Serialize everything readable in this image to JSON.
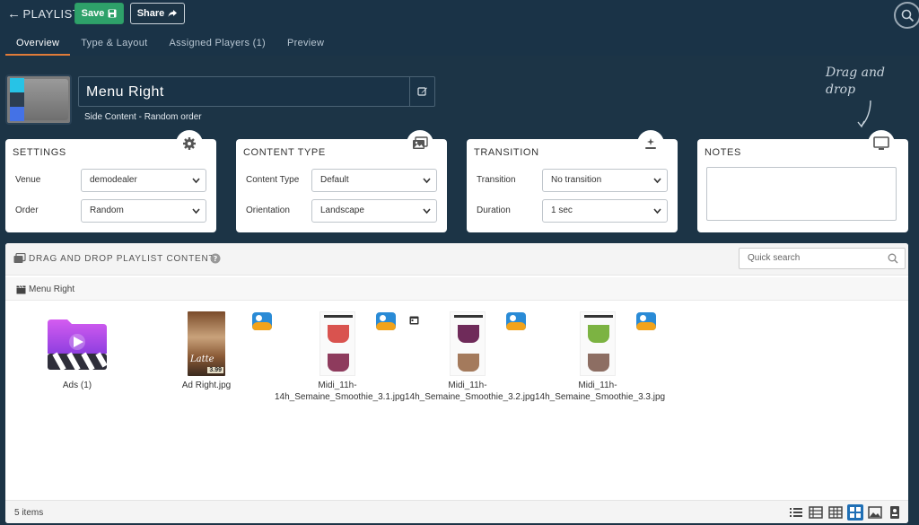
{
  "topbar": {
    "back_label": "PLAYLIST",
    "save_label": "Save",
    "share_label": "Share"
  },
  "tabs": [
    {
      "label": "Overview",
      "active": true
    },
    {
      "label": "Type & Layout",
      "active": false
    },
    {
      "label": "Assigned Players (1)",
      "active": false
    },
    {
      "label": "Preview",
      "active": false
    }
  ],
  "playlist": {
    "title": "Menu Right",
    "subtitle": "Side Content - Random order"
  },
  "drag_hint": "Drag and drop",
  "settings": {
    "title": "SETTINGS",
    "venue_label": "Venue",
    "venue_value": "demodealer",
    "order_label": "Order",
    "order_value": "Random"
  },
  "content_type": {
    "title": "CONTENT TYPE",
    "type_label": "Content Type",
    "type_value": "Default",
    "orientation_label": "Orientation",
    "orientation_value": "Landscape"
  },
  "transition": {
    "title": "TRANSITION",
    "transition_label": "Transition",
    "transition_value": "No transition",
    "duration_label": "Duration",
    "duration_value": "1 sec"
  },
  "notes": {
    "title": "NOTES"
  },
  "content_panel": {
    "title": "DRAG AND DROP PLAYLIST CONTENT",
    "search_placeholder": "Quick search",
    "breadcrumb": "Menu Right",
    "items": [
      {
        "label": "Ads (1)"
      },
      {
        "label": "Ad Right.jpg",
        "price": "3.99"
      },
      {
        "label_line1": "Midi_11h-",
        "label_line2": "14h_Semaine_Smoothie_3.1.jpg"
      },
      {
        "label_line1": "Midi_11h-",
        "label_line2": "14h_Semaine_Smoothie_3.2.jpg"
      },
      {
        "label_line1": "Midi_11h-",
        "label_line2": "14h_Semaine_Smoothie_3.3.jpg"
      }
    ],
    "item_count": "5 items"
  },
  "colors": {
    "bg": "#1c3446",
    "accent_tab": "#e07b39",
    "save_green": "#2ea16a",
    "badge_blue": "#2a8bd6",
    "active_view": "#1f6fb5"
  }
}
